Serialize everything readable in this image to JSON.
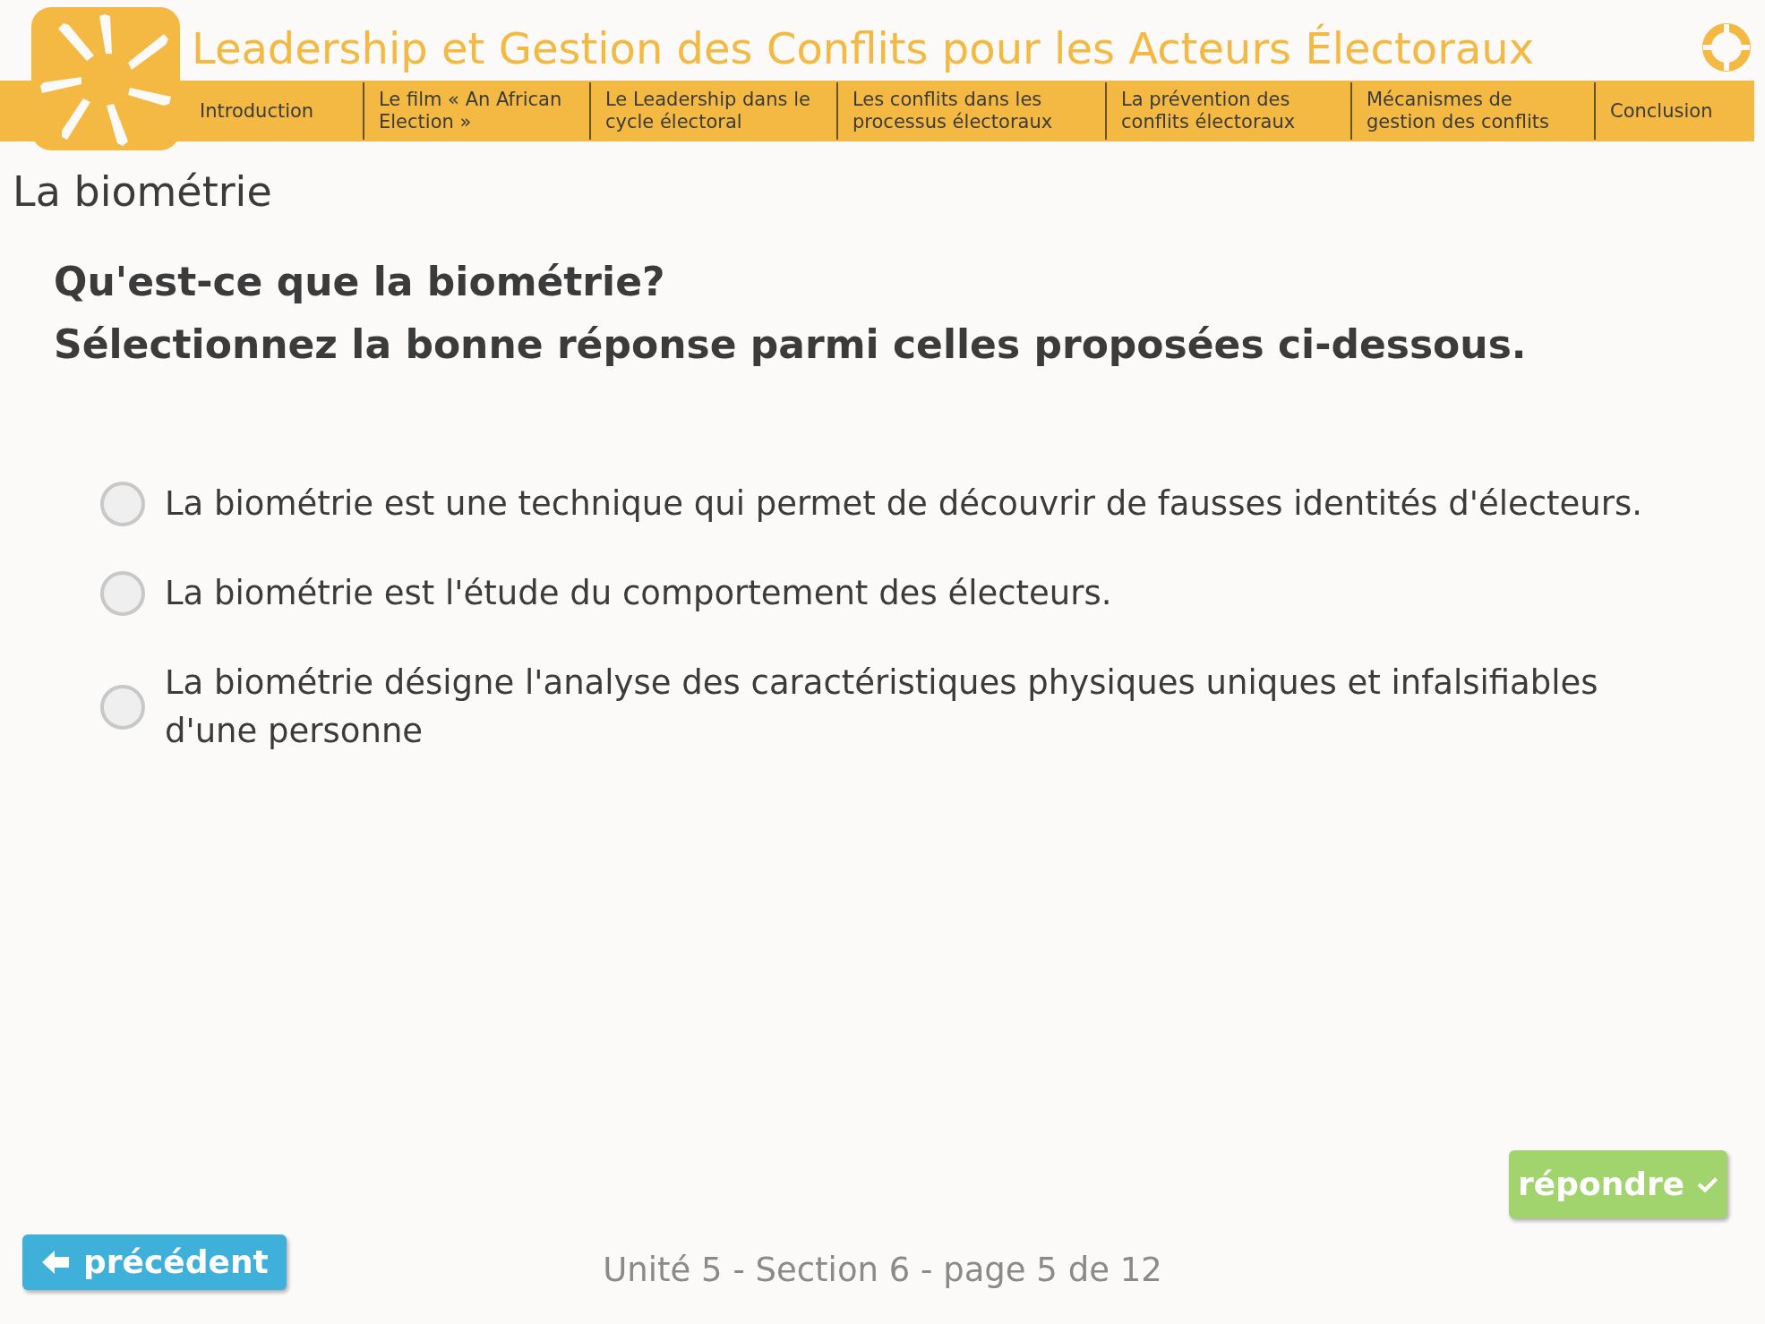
{
  "header": {
    "title": "Leadership et Gestion des Conflits pour les Acteurs Électoraux"
  },
  "nav": [
    {
      "label": "Introduction"
    },
    {
      "label": "Le film « An African Election »"
    },
    {
      "label": "Le Leadership dans le cycle électoral"
    },
    {
      "label": "Les conflits dans les processus électoraux"
    },
    {
      "label": "La prévention des conflits électoraux"
    },
    {
      "label": "Mécanismes de gestion des conflits"
    },
    {
      "label": "Conclusion"
    }
  ],
  "page_title": "La biométrie",
  "question": [
    "Qu'est-ce que la biométrie?",
    "Sélectionnez la bonne réponse parmi celles proposées ci-dessous."
  ],
  "options": [
    {
      "label": "La biométrie est une technique qui permet de découvrir de fausses identités d'électeurs.",
      "selected": false
    },
    {
      "label": "La biométrie est l'étude du comportement des électeurs.",
      "selected": false
    },
    {
      "label": "La biométrie désigne l'analyse des caractéristiques physiques uniques et infalsifiables d'une personne",
      "selected": false
    }
  ],
  "submit_button": "répondre",
  "previous_button": "précédent",
  "footer": "Unité 5 - Section 6 - page 5 de 12"
}
